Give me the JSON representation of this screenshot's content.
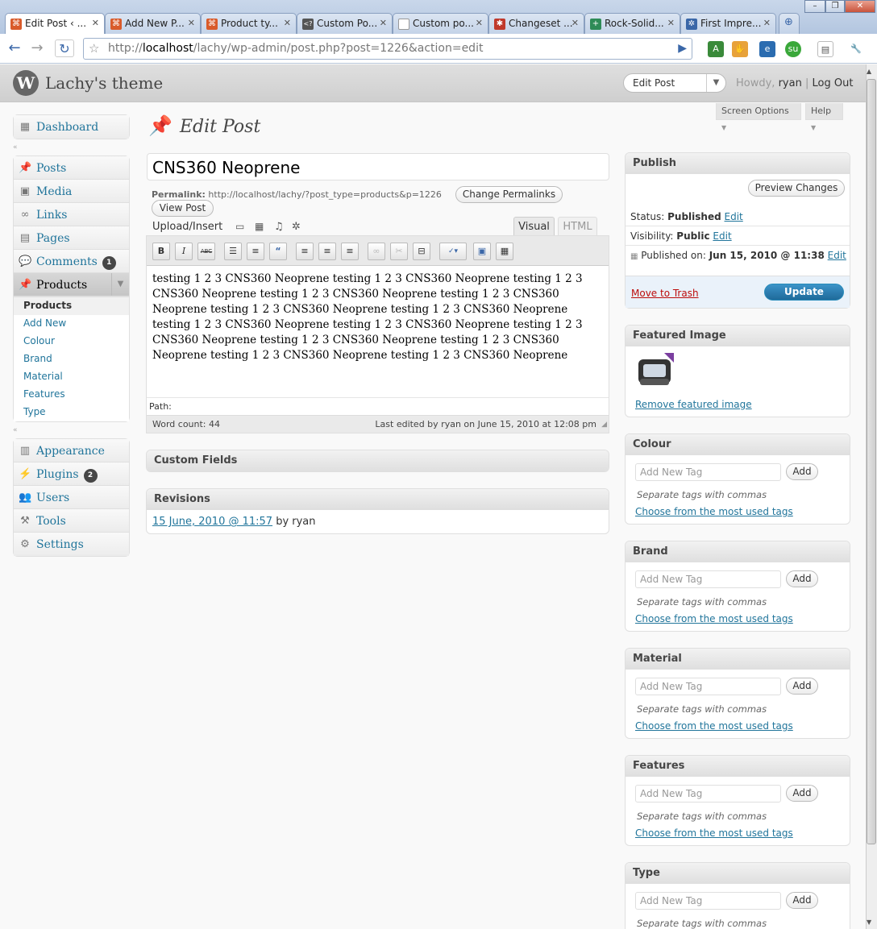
{
  "browser": {
    "tabs": [
      {
        "label": "Edit Post ‹ ...",
        "favicon_color": "#d95b2b"
      },
      {
        "label": "Add New P...",
        "favicon_color": "#d95b2b"
      },
      {
        "label": "Product ty...",
        "favicon_color": "#d95b2b"
      },
      {
        "label": "Custom Po...",
        "favicon_color": "#555555"
      },
      {
        "label": "Custom po...",
        "favicon_color": "#999999"
      },
      {
        "label": "Changeset ...",
        "favicon_color": "#c0392b"
      },
      {
        "label": "Rock-Solid...",
        "favicon_color": "#2e8b57"
      },
      {
        "label": "First Impre...",
        "favicon_color": "#3a67a8"
      }
    ],
    "new_tab_icon": "plus-icon",
    "url_host_prefix": "http://",
    "url_host": "localhost",
    "url_path": "/lachy/wp-admin/post.php?post=1226&action=edit"
  },
  "wp": {
    "site_name": "Lachy's theme",
    "favorite_action": "Edit Post",
    "howdy": "Howdy, ",
    "user": "ryan",
    "separator": "|",
    "logout": "Log Out",
    "screen_options": "Screen Options",
    "help": "Help",
    "page_title": "Edit Post"
  },
  "menu": {
    "dashboard": "Dashboard",
    "posts": "Posts",
    "media": "Media",
    "links": "Links",
    "pages": "Pages",
    "comments": "Comments",
    "comments_count": "1",
    "products": "Products",
    "products_sub": [
      "Products",
      "Add New",
      "Colour",
      "Brand",
      "Material",
      "Features",
      "Type"
    ],
    "appearance": "Appearance",
    "plugins": "Plugins",
    "plugins_count": "2",
    "users": "Users",
    "tools": "Tools",
    "settings": "Settings"
  },
  "editor": {
    "title_value": "CNS360 Neoprene",
    "permalink_label": "Permalink:",
    "permalink_url": "http://localhost/lachy/?post_type=products&p=1226",
    "change_permalinks": "Change Permalinks",
    "view_post": "View Post",
    "upload_insert": "Upload/Insert",
    "tab_visual": "Visual",
    "tab_html": "HTML",
    "content": "testing 1 2 3 CNS360 Neoprene testing 1 2 3 CNS360 Neoprene testing 1 2 3 CNS360 Neoprene testing 1 2 3 CNS360 Neoprene testing 1 2 3 CNS360 Neoprene testing 1 2 3 CNS360 Neoprene testing 1 2 3 CNS360 Neoprene testing 1 2 3 CNS360 Neoprene testing 1 2 3 CNS360 Neoprene testing 1 2 3 CNS360 Neoprene testing 1 2 3 CNS360 Neoprene testing 1 2 3 CNS360 Neoprene testing 1 2 3 CNS360 Neoprene testing 1 2 3 CNS360 Neoprene",
    "path_label": "Path:",
    "word_count": "Word count: 44",
    "last_edited": "Last edited by ryan on June 15, 2010 at 12:08 pm"
  },
  "custom_fields": {
    "title": "Custom Fields"
  },
  "revisions": {
    "title": "Revisions",
    "date_link": "15 June, 2010 @ 11:57",
    "by": " by ryan"
  },
  "publish": {
    "title": "Publish",
    "preview": "Preview Changes",
    "status_label": "Status:",
    "status_value": "Published",
    "visibility_label": "Visibility:",
    "visibility_value": "Public",
    "published_on_label": "Published on:",
    "published_on_value": "Jun 15, 2010 @ 11:38",
    "edit": "Edit",
    "trash": "Move to Trash",
    "update": "Update"
  },
  "featured_image": {
    "title": "Featured Image",
    "remove": "Remove featured image"
  },
  "taxonomy_boxes": [
    {
      "title": "Colour"
    },
    {
      "title": "Brand"
    },
    {
      "title": "Material"
    },
    {
      "title": "Features"
    },
    {
      "title": "Type"
    }
  ],
  "taxonomy_common": {
    "placeholder": "Add New Tag",
    "add": "Add",
    "hint": "Separate tags with commas",
    "most_used": "Choose from the most used tags"
  },
  "colors": {
    "link": "#21759b",
    "update_button": "#21759b",
    "trash": "#bc0b0b"
  }
}
